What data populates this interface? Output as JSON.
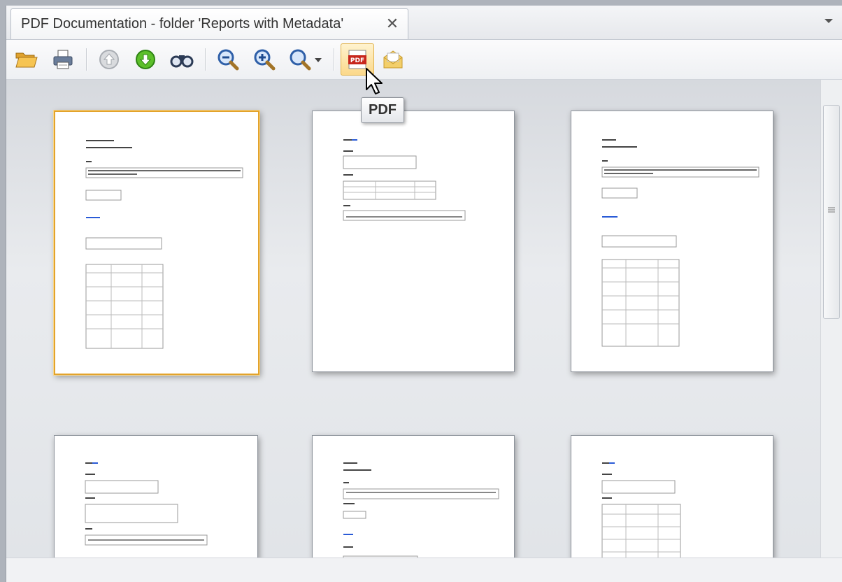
{
  "tab": {
    "title": "PDF Documentation - folder 'Reports with Metadata'",
    "close_glyph": "✕"
  },
  "toolbar": {
    "buttons": [
      {
        "icon": "open-folder-icon"
      },
      {
        "icon": "print-icon"
      },
      {
        "icon": "previous-page-icon"
      },
      {
        "icon": "next-page-icon"
      },
      {
        "icon": "find-icon"
      },
      {
        "icon": "zoom-out-icon"
      },
      {
        "icon": "zoom-in-icon"
      },
      {
        "icon": "zoom-dropdown-icon"
      },
      {
        "icon": "pdf-export-icon",
        "active": true
      },
      {
        "icon": "email-icon"
      }
    ]
  },
  "tooltip": {
    "text": "PDF"
  },
  "colors": {
    "selected_page_border": "#e3a32b",
    "active_button_bg": "#fbd88a"
  },
  "pages": [
    {
      "selected": true
    },
    {
      "selected": false
    },
    {
      "selected": false
    },
    {
      "selected": false
    },
    {
      "selected": false
    },
    {
      "selected": false
    }
  ]
}
